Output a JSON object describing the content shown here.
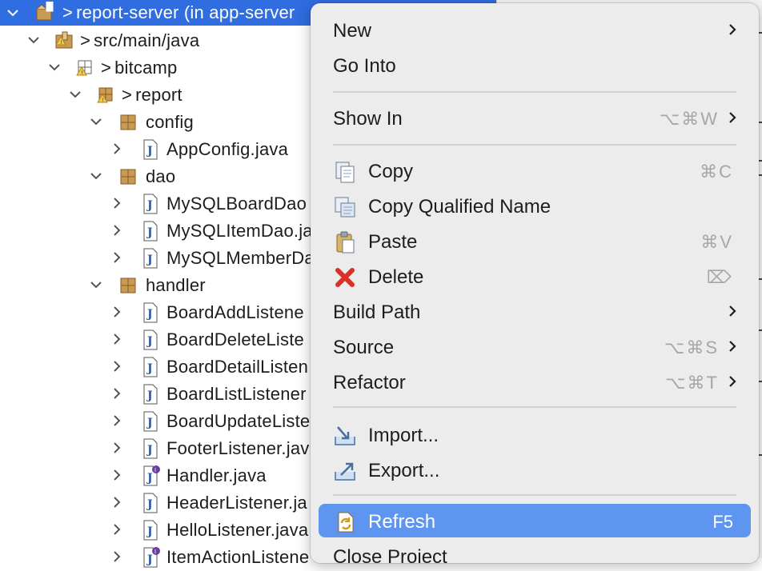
{
  "tree": {
    "rows": [
      {
        "prefix": ">",
        "label": "report-server (in app-server",
        "icon": "project-icon",
        "selected": true,
        "indent": 0
      },
      {
        "prefix": ">",
        "label": "src/main/java",
        "icon": "source-folder-icon",
        "indent": 1
      },
      {
        "prefix": ">",
        "label": "bitcamp",
        "icon": "package-icon",
        "indent": 2
      },
      {
        "prefix": ">",
        "label": "report",
        "icon": "package-icon",
        "indent": 3
      },
      {
        "prefix": "",
        "label": "config",
        "icon": "package-icon",
        "indent": 4
      },
      {
        "prefix": "",
        "label": "AppConfig.java",
        "icon": "java-file-icon",
        "indent": 5
      },
      {
        "prefix": "",
        "label": "dao",
        "icon": "package-icon",
        "indent": 4
      },
      {
        "prefix": "",
        "label": "MySQLBoardDao",
        "icon": "java-file-icon",
        "indent": 5
      },
      {
        "prefix": "",
        "label": "MySQLItemDao.ja",
        "icon": "java-file-icon",
        "indent": 5
      },
      {
        "prefix": "",
        "label": "MySQLMemberDa",
        "icon": "java-file-icon",
        "indent": 5
      },
      {
        "prefix": "",
        "label": "handler",
        "icon": "package-icon",
        "indent": 4
      },
      {
        "prefix": "",
        "label": "BoardAddListene",
        "icon": "java-file-icon",
        "indent": 5
      },
      {
        "prefix": "",
        "label": "BoardDeleteListe",
        "icon": "java-file-icon",
        "indent": 5
      },
      {
        "prefix": "",
        "label": "BoardDetailListen",
        "icon": "java-file-icon",
        "indent": 5
      },
      {
        "prefix": "",
        "label": "BoardListListener",
        "icon": "java-file-icon",
        "indent": 5
      },
      {
        "prefix": "",
        "label": "BoardUpdateListe",
        "icon": "java-file-icon",
        "indent": 5
      },
      {
        "prefix": "",
        "label": "FooterListener.jav",
        "icon": "java-file-icon",
        "indent": 5
      },
      {
        "prefix": "",
        "label": "Handler.java",
        "icon": "java-interface-icon",
        "indent": 5
      },
      {
        "prefix": "",
        "label": "HeaderListener.ja",
        "icon": "java-file-icon",
        "indent": 5
      },
      {
        "prefix": "",
        "label": "HelloListener.java",
        "icon": "java-file-icon",
        "indent": 5
      },
      {
        "prefix": "",
        "label": "ItemActionListene",
        "icon": "java-interface-icon",
        "indent": 5
      }
    ]
  },
  "context_menu": {
    "items": [
      {
        "type": "item",
        "label": "New",
        "submenu": true
      },
      {
        "type": "item",
        "label": "Go Into"
      },
      {
        "type": "separator"
      },
      {
        "type": "item",
        "label": "Show In",
        "shortcut": "⌥⌘W",
        "submenu": true
      },
      {
        "type": "separator"
      },
      {
        "type": "item",
        "label": "Copy",
        "shortcut": "⌘C",
        "icon": "copy-icon"
      },
      {
        "type": "item",
        "label": "Copy Qualified Name",
        "icon": "copy-qualified-name-icon"
      },
      {
        "type": "item",
        "label": "Paste",
        "shortcut": "⌘V",
        "icon": "paste-icon"
      },
      {
        "type": "item",
        "label": "Delete",
        "shortcut": "⌦",
        "icon": "delete-icon"
      },
      {
        "type": "item",
        "label": "Build Path",
        "submenu": true
      },
      {
        "type": "item",
        "label": "Source",
        "shortcut": "⌥⌘S",
        "submenu": true
      },
      {
        "type": "item",
        "label": "Refactor",
        "shortcut": "⌥⌘T",
        "submenu": true
      },
      {
        "type": "separator"
      },
      {
        "type": "item",
        "label": "Import...",
        "icon": "import-icon"
      },
      {
        "type": "item",
        "label": "Export...",
        "icon": "export-icon"
      },
      {
        "type": "separator"
      },
      {
        "type": "item",
        "label": "Refresh",
        "shortcut": "F5",
        "icon": "refresh-icon",
        "highlighted": true
      },
      {
        "type": "item",
        "label": "Close Project"
      }
    ]
  },
  "colors": {
    "selection": "#2f6de0",
    "menu_highlight": "#5e95f0",
    "menu_background": "#ececec",
    "shortcut_text": "#a6a6a6"
  }
}
